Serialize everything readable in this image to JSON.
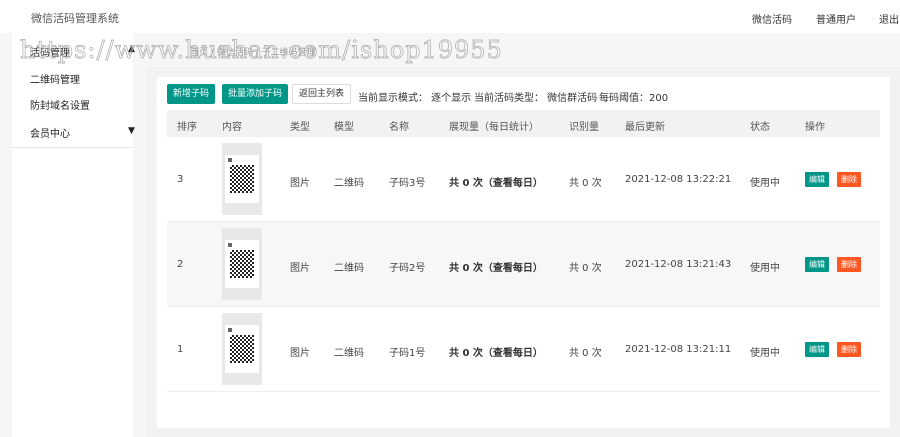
{
  "app": {
    "title": "微信活码管理系统",
    "nav": [
      "微信活码",
      "普通用户",
      "退出"
    ]
  },
  "breadcrumb": "首页 / 微信活码 / 子二维码管理",
  "watermark": "https://www.huzhan.com/ishop19955",
  "sidebar": {
    "items": [
      {
        "label": "活码管理"
      },
      {
        "label": "二维码管理"
      },
      {
        "label": "防封域名设置"
      },
      {
        "label": "会员中心"
      }
    ]
  },
  "toolbar": {
    "add": "新增子码",
    "batch_add": "批量添加子码",
    "back": "返回主列表",
    "mode": "当前显示模式：  逐个显示",
    "type": "当前活码类型：  微信群活码",
    "threshold": "每码阈值：200"
  },
  "table": {
    "headers": [
      "排序",
      "内容",
      "类型",
      "模型",
      "名称",
      "展现量（每日统计）",
      "识别量",
      "最后更新",
      "状态",
      "操作"
    ],
    "rows": [
      {
        "order": "3",
        "type": "图片",
        "model": "二维码",
        "name": "子码3号",
        "views": "共 0 次（查看每日）",
        "scans": "共 0 次",
        "updated": "2021-12-08 13:22:21",
        "status": "使用中"
      },
      {
        "order": "2",
        "type": "图片",
        "model": "二维码",
        "name": "子码2号",
        "views": "共 0 次（查看每日）",
        "scans": "共 0 次",
        "updated": "2021-12-08 13:21:43",
        "status": "使用中"
      },
      {
        "order": "1",
        "type": "图片",
        "model": "二维码",
        "name": "子码1号",
        "views": "共 0 次（查看每日）",
        "scans": "共 0 次",
        "updated": "2021-12-08 13:21:11",
        "status": "使用中"
      }
    ],
    "edit": "编辑",
    "delete": "删除"
  },
  "colors": {
    "primary": "#009688",
    "danger": "#ff5722"
  }
}
